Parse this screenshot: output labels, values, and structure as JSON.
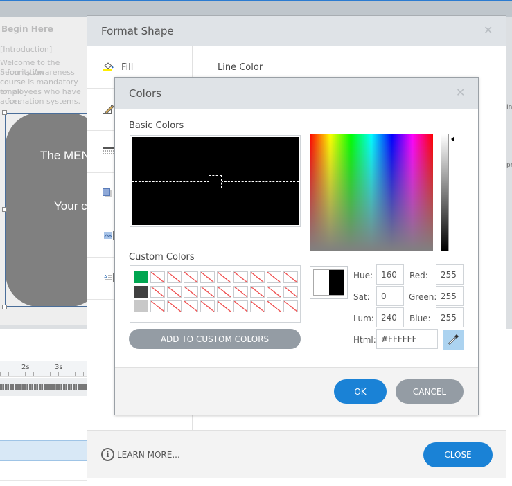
{
  "background": {
    "slide_title": "Begin Here",
    "slide_text": [
      "[Introduction]",
      "Welcome to the Information",
      "Security Awareness course",
      "course is mandatory for all",
      "employees who have acces",
      "information systems."
    ],
    "shape_text_1": "The MEN",
    "shape_text_2": "Your c",
    "ruler_labels": [
      "2s",
      "3s"
    ],
    "right_fragments": [
      "Inf",
      "pr"
    ]
  },
  "format_shape": {
    "title": "Format Shape",
    "close_icon": "close-icon",
    "sidebar": [
      {
        "label": "Fill",
        "icon": "paint-bucket-icon",
        "active": true
      },
      {
        "label": "",
        "icon": "pencil-icon"
      },
      {
        "label": "",
        "icon": "line-style-icon"
      },
      {
        "label": "",
        "icon": "shadow-icon"
      },
      {
        "label": "",
        "icon": "picture-icon"
      },
      {
        "label": "",
        "icon": "text-box-icon"
      }
    ],
    "section_title": "Line Color",
    "learn_more": "LEARN MORE...",
    "close_label": "CLOSE",
    "accent": "#1a82d6"
  },
  "colors_dialog": {
    "title": "Colors",
    "basic_colors_label": "Basic Colors",
    "custom_colors_label": "Custom Colors",
    "custom_colors": [
      "#00a650",
      null,
      null,
      null,
      null,
      null,
      null,
      null,
      null,
      null,
      "#404040",
      null,
      null,
      null,
      null,
      null,
      null,
      null,
      null,
      null,
      "#c8c8c8",
      null,
      null,
      null,
      null,
      null,
      null,
      null,
      null,
      null
    ],
    "add_button": "ADD TO CUSTOM COLORS",
    "fields": {
      "hue": {
        "label": "Hue:",
        "value": "160"
      },
      "sat": {
        "label": "Sat:",
        "value": "0"
      },
      "lum": {
        "label": "Lum:",
        "value": "240"
      },
      "red": {
        "label": "Red:",
        "value": "255"
      },
      "green": {
        "label": "Green:",
        "value": "255"
      },
      "blue": {
        "label": "Blue:",
        "value": "255"
      },
      "html": {
        "label": "Html:",
        "value": "#FFFFFF"
      }
    },
    "preview": {
      "new": "#FFFFFF",
      "old": "#000000"
    },
    "ok_label": "OK",
    "cancel_label": "CANCEL"
  }
}
